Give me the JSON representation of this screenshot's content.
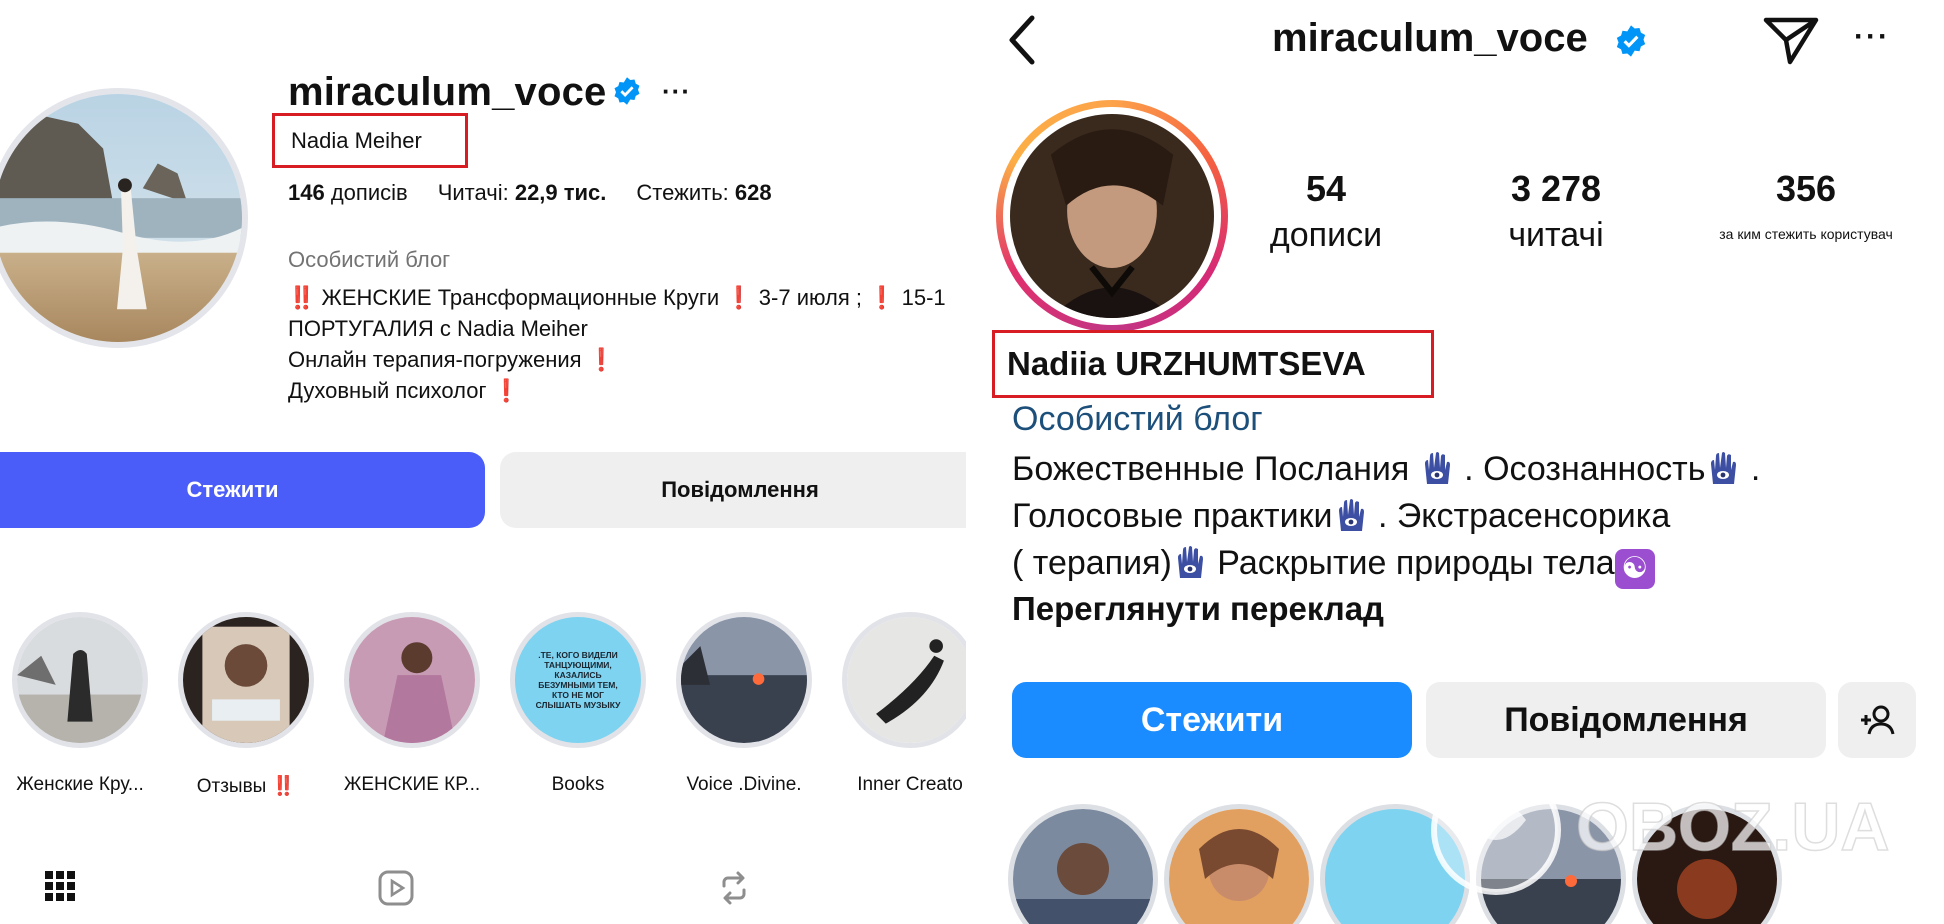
{
  "left": {
    "username": "miraculum_voce",
    "more": "···",
    "full_name": "Nadia Meiher",
    "stats": [
      {
        "value": "146",
        "label": "дописів"
      },
      {
        "label": "Читачі:",
        "value": "22,9 тис."
      },
      {
        "label": "Стежить:",
        "value": "628"
      }
    ],
    "category": "Особистий блог",
    "bio": {
      "line1_a": "‼️",
      "line1_b": " ЖЕНСКИЕ Трансформационные Круги ",
      "line1_c": "❗",
      "line1_d": " 3-7 июля ; ",
      "line1_e": "❗",
      "line1_f": " 15-1",
      "line2": "ПОРТУГАЛИЯ с Nadia Meiher",
      "line3_a": "Онлайн терапия-погружения ",
      "line3_b": "❗",
      "line4_a": "Духовный психолог ",
      "line4_b": "❗"
    },
    "follow_label": "Стежити",
    "message_label": "Повідомлення",
    "highlights": [
      {
        "label": "Женские Кру...",
        "mark": ""
      },
      {
        "label": "Отзывы ",
        "mark": "‼️"
      },
      {
        "label": "ЖЕНСКИЕ КР...",
        "mark": ""
      },
      {
        "label": "Books",
        "mark": ""
      },
      {
        "label": "Voice .Divine.",
        "mark": ""
      },
      {
        "label": "Inner Creato",
        "mark": ""
      }
    ],
    "books_cover_text": [
      ".ТЕ, КОГО ВИДЕЛИ",
      "ТАНЦУЮЩИМИ,",
      "КАЗАЛИСЬ",
      "БЕЗУМНЫМИ ТЕМ,",
      "КТО НЕ МОГ",
      "СЛЫШАТЬ МУЗЫКУ"
    ]
  },
  "right": {
    "username": "miraculum_voce",
    "stats": [
      {
        "value": "54",
        "label": "дописи"
      },
      {
        "value": "3 278",
        "label": "читачі"
      },
      {
        "value": "356",
        "label": "за ким стежить користувач"
      }
    ],
    "full_name": "Nadiia URZHUMTSEVA",
    "category": "Особистий блог",
    "bio": {
      "line1_a": "Божественные Послания ",
      "line1_b": " . Осознанность",
      "line1_c": " .",
      "line2_a": "Голосовые практики",
      "line2_b": " . Экстрасенсорика",
      "line3_a": "( терапия)",
      "line3_b": " Раскрытие природы тела",
      "yin_yang": "☯"
    },
    "see_translation": "Переглянути переклад",
    "follow_label": "Стежити",
    "message_label": "Повідомлення",
    "watermark": "OBOZ.UA"
  },
  "colors": {
    "highlight_box": "#d71c24",
    "left_follow": "#4a5df9",
    "right_follow": "#1a8cff",
    "verified": "#0095f6"
  }
}
